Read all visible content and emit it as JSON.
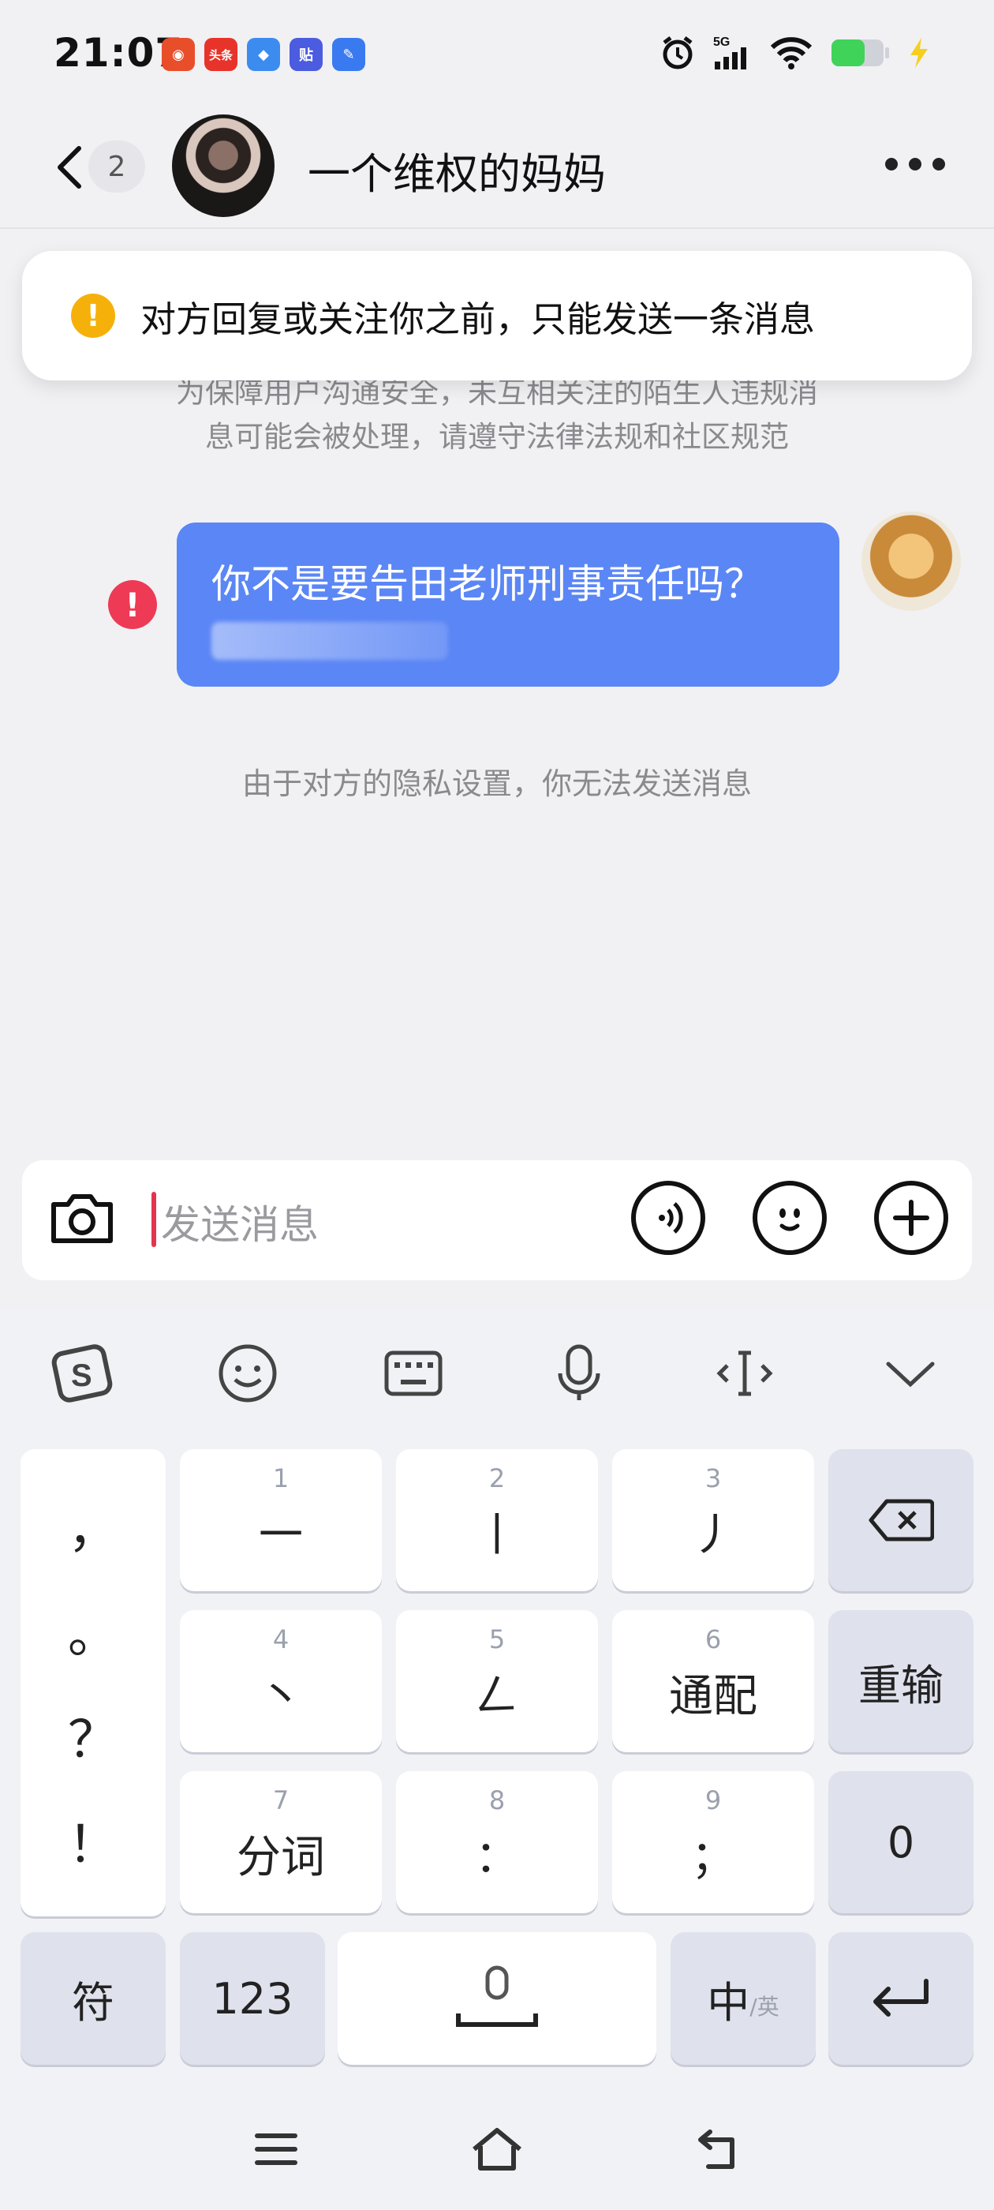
{
  "status_bar": {
    "time": "21:07",
    "notifications": [
      {
        "icon": "weibo-icon",
        "color": "#e94e2a",
        "label": ""
      },
      {
        "icon": "toutiao-icon",
        "color": "#e8332a",
        "label": "头条"
      },
      {
        "icon": "alipay-icon",
        "color": "#3c8cf0",
        "label": ""
      },
      {
        "icon": "tieba-icon",
        "color": "#4b5ce0",
        "label": "贴"
      },
      {
        "icon": "note-icon",
        "color": "#3a7af0",
        "label": ""
      }
    ],
    "network": "5G",
    "battery_color": "#3fd35a"
  },
  "header": {
    "unread_count": "2",
    "peer_name": "一个维权的妈妈"
  },
  "toast": {
    "text": "对方回复或关注你之前，只能发送一条消息"
  },
  "chat": {
    "safety_notice_line1": "为保障用户沟通安全，未互相关注的陌生人违规消",
    "safety_notice_line2": "息可能会被处理，请遵守法律法规和社区规范",
    "message_text": "你不是要告田老师刑事责任吗？",
    "privacy_notice": "由于对方的隐私设置，你无法发送消息"
  },
  "input": {
    "placeholder": "发送消息"
  },
  "keyboard": {
    "symbols": [
      "，",
      "。",
      "？",
      "！"
    ],
    "keys": [
      {
        "num": "1",
        "label": "一"
      },
      {
        "num": "2",
        "label": "丨"
      },
      {
        "num": "3",
        "label": "丿"
      },
      {
        "num": "4",
        "label": "丶"
      },
      {
        "num": "5",
        "label": "𠃋"
      },
      {
        "num": "6",
        "label": "通配"
      },
      {
        "num": "7",
        "label": "分词"
      },
      {
        "num": "8",
        "label": "："
      },
      {
        "num": "9",
        "label": "；"
      }
    ],
    "reinput": "重输",
    "zero": "0",
    "symbol_key": "符",
    "num_key": "123",
    "lang_main": "中",
    "lang_sub": "/英"
  },
  "colors": {
    "bubble": "#5b86f5",
    "warning": "#f5b10a",
    "error": "#ee3a55",
    "cursor": "#e3344f"
  }
}
